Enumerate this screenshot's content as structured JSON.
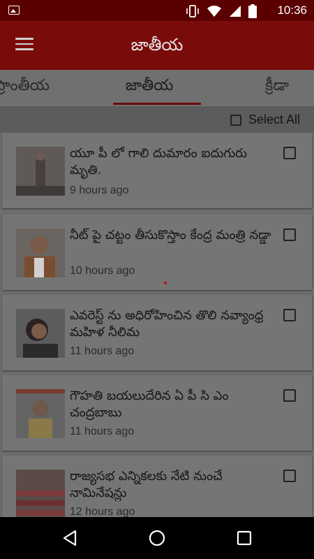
{
  "status_bar": {
    "time": "10:36",
    "icons": [
      "image-icon",
      "vibrate-icon",
      "wifi-icon",
      "signal-icon",
      "battery-icon"
    ]
  },
  "app_bar": {
    "title": "జాతీయ",
    "menu_icon": "hamburger-menu-icon"
  },
  "tabs": [
    {
      "label": "ప్రాంతీయ",
      "active": false
    },
    {
      "label": "జాతీయ",
      "active": true
    },
    {
      "label": "క్రీడా",
      "active": false
    }
  ],
  "select_all": {
    "label": "Select All",
    "checked": false
  },
  "articles": [
    {
      "headline": "యూ పీ లో గాలి దుమారం ఐదుగురు మృతి.",
      "time": "9 hours ago",
      "checked": false
    },
    {
      "headline": "నీట్ పై చట్టం తీసుకొస్తాం కేంద్ర మంత్రి నడ్డా",
      "time": "10 hours ago",
      "checked": false
    },
    {
      "headline": "ఎవరెస్ట్ ను అధిరోహించిన తొలి నవ్యాంధ్ర మహిళ నీలిమ",
      "time": "11 hours ago",
      "checked": false
    },
    {
      "headline": "గౌహతి బయలుదేరిన ఏ పీ సి ఎం చంద్రబాబు",
      "time": "11 hours ago",
      "checked": false
    },
    {
      "headline": "రాజ్యసభ ఎన్నికలకు నేటి నుంచే నామినేషన్లు",
      "time": "12 hours ago",
      "checked": false
    }
  ],
  "nav_bar": {
    "back": "back-triangle-icon",
    "home": "home-circle-icon",
    "recents": "recents-square-icon"
  },
  "colors": {
    "app_bar": "#7a0b0b",
    "status_bar": "#5a0000",
    "overlay": "#6e6e6e",
    "tab_indicator": "#6a0a0a"
  }
}
